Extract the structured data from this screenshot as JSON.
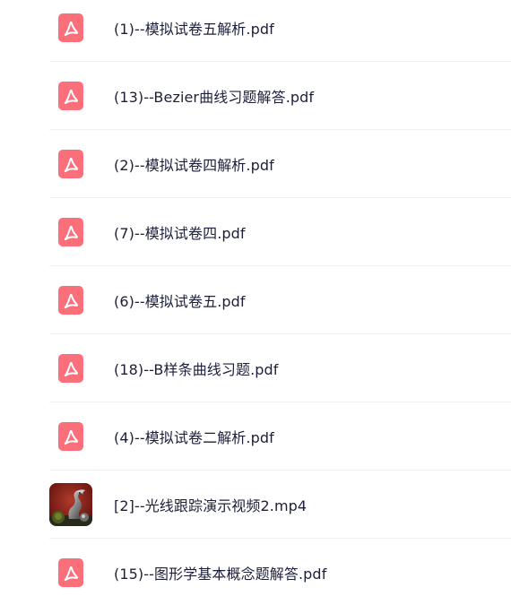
{
  "colors": {
    "pdf_icon": "#fb6f7b",
    "text": "#1d1f3a",
    "divider": "#f1f1f3"
  },
  "files": [
    {
      "name": "(1)--模拟试卷五解析.pdf",
      "icon": "pdf-icon"
    },
    {
      "name": "(13)--Bezier曲线习题解答.pdf",
      "icon": "pdf-icon"
    },
    {
      "name": "(2)--模拟试卷四解析.pdf",
      "icon": "pdf-icon"
    },
    {
      "name": "(7)--模拟试卷四.pdf",
      "icon": "pdf-icon"
    },
    {
      "name": "(6)--模拟试卷五.pdf",
      "icon": "pdf-icon"
    },
    {
      "name": "(18)--B样条曲线习题.pdf",
      "icon": "pdf-icon"
    },
    {
      "name": "(4)--模拟试卷二解析.pdf",
      "icon": "pdf-icon"
    },
    {
      "name": "[2]--光线跟踪演示视频2.mp4",
      "icon": "video-thumbnail"
    },
    {
      "name": "(15)--图形学基本概念题解答.pdf",
      "icon": "pdf-icon"
    }
  ]
}
